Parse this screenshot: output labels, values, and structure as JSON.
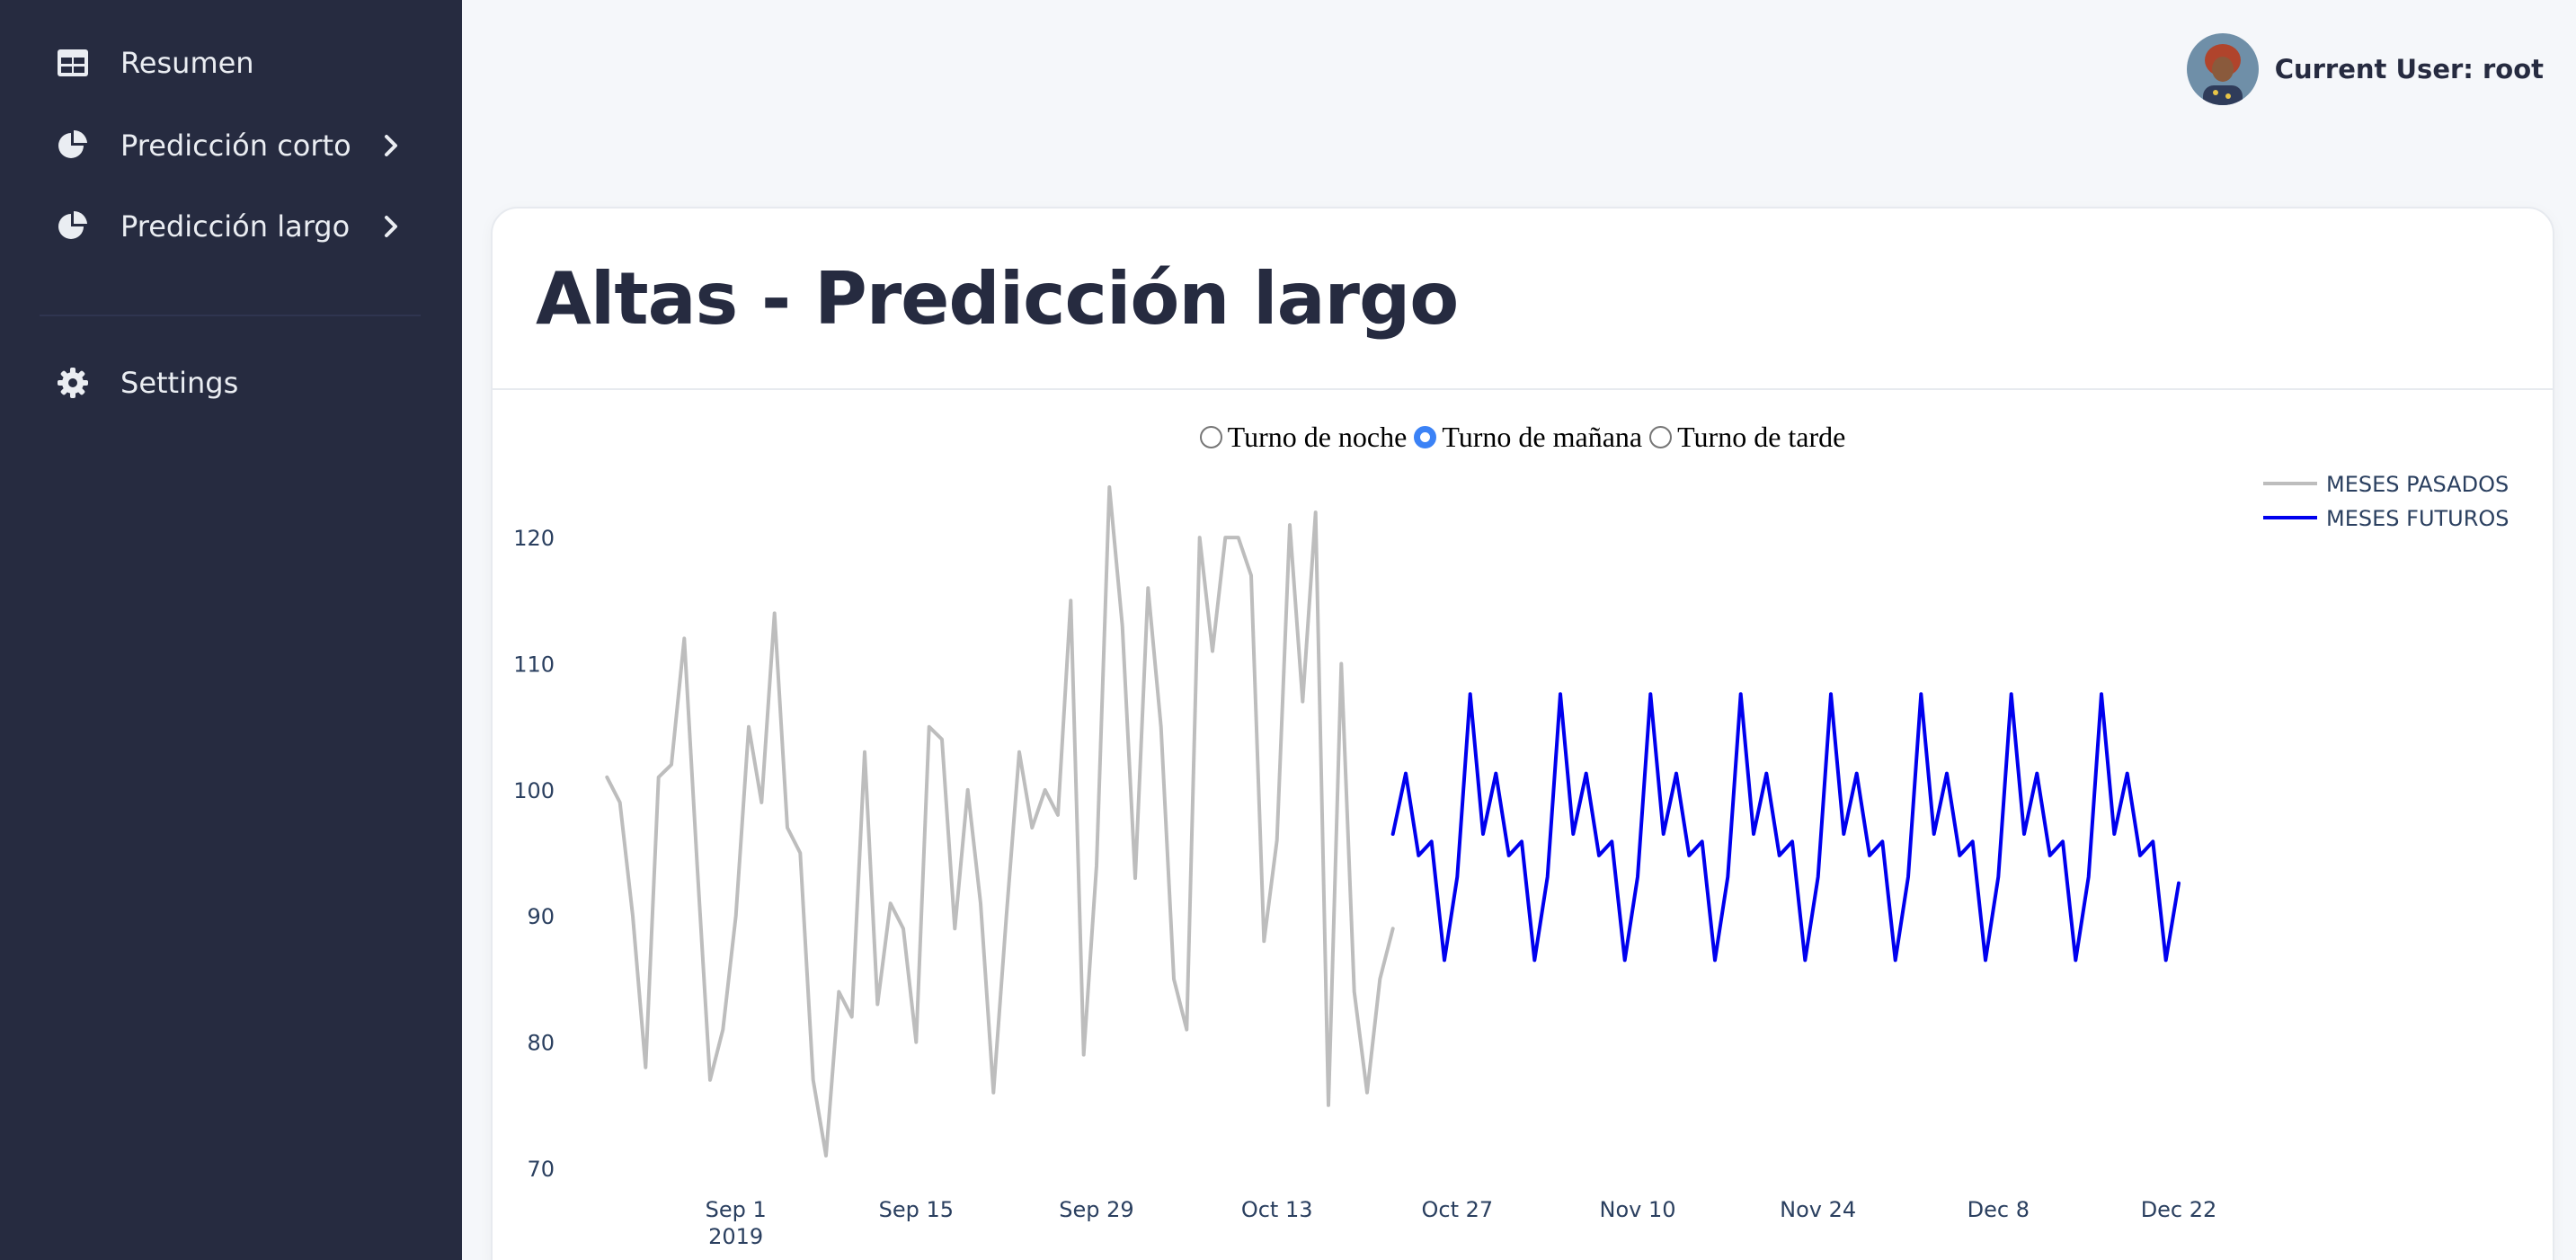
{
  "sidebar": {
    "items": [
      {
        "label": "Resumen",
        "icon": "table-icon"
      },
      {
        "label": "Predicción corto",
        "icon": "pie-chart-icon"
      },
      {
        "label": "Predicción largo",
        "icon": "pie-chart-icon"
      },
      {
        "label": "Settings",
        "icon": "gear-icon"
      }
    ]
  },
  "header": {
    "user_label": "Current User: root"
  },
  "card": {
    "title": "Altas - Predicción largo"
  },
  "radios": [
    {
      "label": "Turno de noche",
      "checked": false
    },
    {
      "label": "Turno de mañana",
      "checked": true
    },
    {
      "label": "Turno de tarde",
      "checked": false
    }
  ],
  "colors": {
    "sidebar_bg": "#262b40",
    "past_series": "#bdbdbd",
    "future_series": "#0000ee"
  },
  "chart_data": {
    "type": "line",
    "title": "",
    "xlabel": "",
    "ylabel": "",
    "ylim": [
      69,
      124
    ],
    "yticks": [
      70,
      80,
      90,
      100,
      110,
      120
    ],
    "xlim": [
      "2019-08-21",
      "2019-12-28"
    ],
    "xticks": [
      {
        "date": "2019-09-01",
        "label": "Sep 1",
        "sublabel": "2019"
      },
      {
        "date": "2019-09-15",
        "label": "Sep 15"
      },
      {
        "date": "2019-09-29",
        "label": "Sep 29"
      },
      {
        "date": "2019-10-13",
        "label": "Oct 13"
      },
      {
        "date": "2019-10-27",
        "label": "Oct 27"
      },
      {
        "date": "2019-11-10",
        "label": "Nov 10"
      },
      {
        "date": "2019-11-24",
        "label": "Nov 24"
      },
      {
        "date": "2019-12-08",
        "label": "Dec 8"
      },
      {
        "date": "2019-12-22",
        "label": "Dec 22"
      }
    ],
    "legend_position": "top-right",
    "series": [
      {
        "name": "MESES PASADOS",
        "color": "#bdbdbd",
        "start_date": "2019-08-22",
        "values": [
          101,
          99,
          90,
          78,
          101,
          102,
          112,
          94,
          77,
          81,
          90,
          105,
          99,
          114,
          97,
          95,
          77,
          71,
          84,
          82,
          103,
          83,
          91,
          89,
          80,
          105,
          104,
          89,
          100,
          91,
          76,
          90,
          103,
          97,
          100,
          98,
          115,
          79,
          94,
          124,
          113,
          93,
          116,
          105,
          85,
          81,
          120,
          111,
          120,
          120,
          117,
          88,
          96,
          121,
          107,
          122,
          75,
          110,
          84,
          76,
          85,
          89
        ]
      },
      {
        "name": "MESES FUTUROS",
        "color": "#0000ee",
        "start_date": "2019-10-22",
        "values": [
          96.5,
          101.3,
          94.8,
          95.9,
          86.5,
          93.1,
          107.6,
          96.5,
          101.3,
          94.8,
          95.9,
          86.5,
          93.1,
          107.6,
          96.5,
          101.3,
          94.8,
          95.9,
          86.5,
          93.1,
          107.6,
          96.5,
          101.3,
          94.8,
          95.9,
          86.5,
          93.1,
          107.6,
          96.5,
          101.3,
          94.8,
          95.9,
          86.5,
          93.1,
          107.6,
          96.5,
          101.3,
          94.8,
          95.9,
          86.5,
          93.1,
          107.6,
          96.5,
          101.3,
          94.8,
          95.9,
          86.5,
          93.1,
          107.6,
          96.5,
          101.3,
          94.8,
          95.9,
          86.5,
          93.1,
          107.6,
          96.5,
          101.3,
          94.8,
          95.9,
          86.5,
          92.6
        ]
      }
    ]
  }
}
